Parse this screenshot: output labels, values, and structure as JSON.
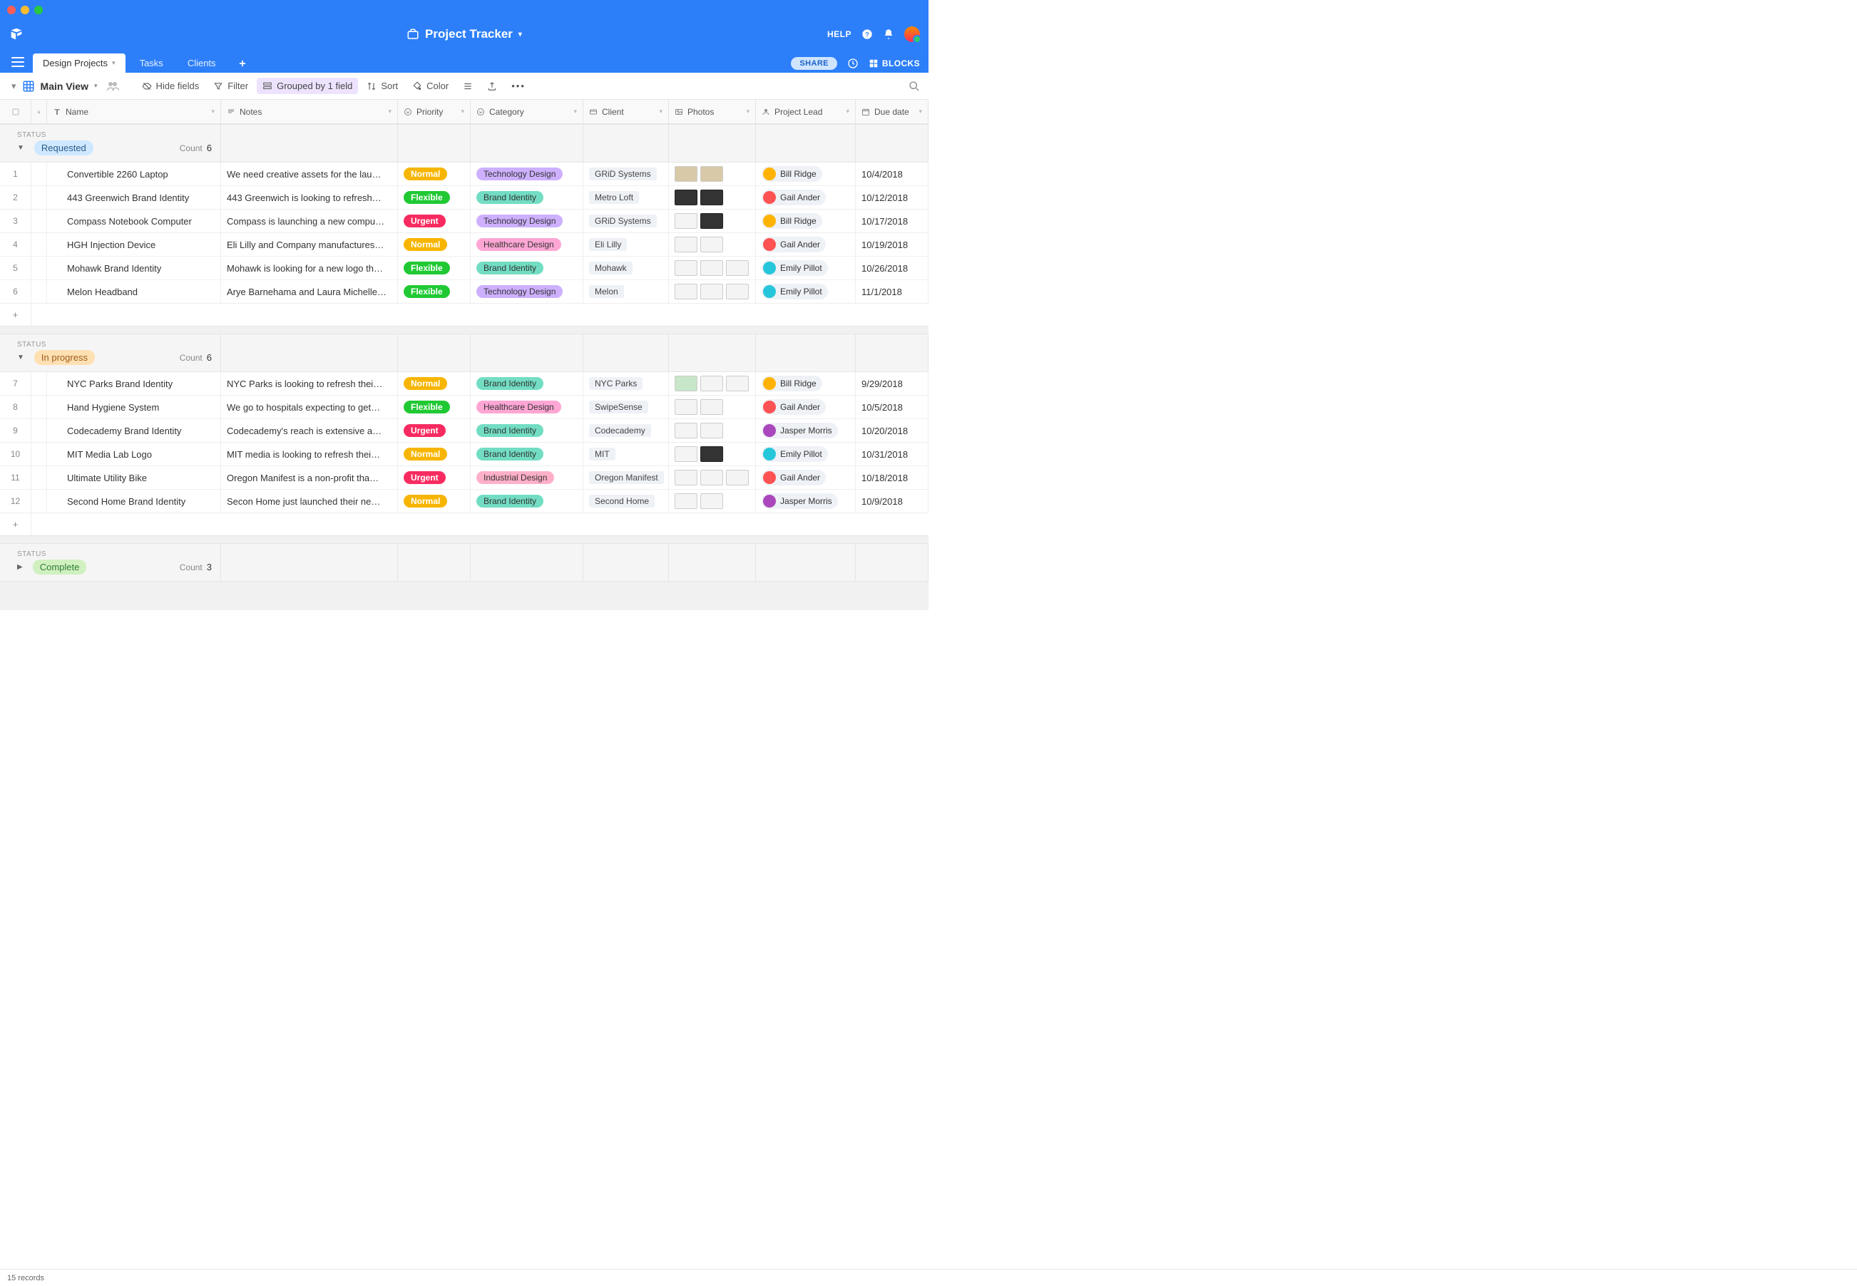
{
  "app": {
    "title": "Project Tracker",
    "help": "HELP",
    "share": "SHARE",
    "blocks": "BLOCKS"
  },
  "tabs": [
    {
      "label": "Design Projects",
      "active": true
    },
    {
      "label": "Tasks",
      "active": false
    },
    {
      "label": "Clients",
      "active": false
    }
  ],
  "view": {
    "name": "Main View",
    "hide_fields": "Hide fields",
    "filter": "Filter",
    "grouped": "Grouped by 1 field",
    "sort": "Sort",
    "color": "Color"
  },
  "columns": {
    "name": "Name",
    "notes": "Notes",
    "priority": "Priority",
    "category": "Category",
    "client": "Client",
    "photos": "Photos",
    "lead": "Project Lead",
    "due": "Due date"
  },
  "status_label": "STATUS",
  "count_label": "Count",
  "groups": [
    {
      "status": "Requested",
      "status_color": "#cfe8ff",
      "status_text": "#2a5a8a",
      "expanded": true,
      "count": 6,
      "rows": [
        {
          "n": 1,
          "name": "Convertible 2260 Laptop",
          "notes": "We need creative assets for the lau…",
          "priority": "Normal",
          "category": "Technology Design",
          "client": "GRiD Systems",
          "lead": "Bill Ridge",
          "due": "10/4/2018",
          "thumbs": [
            "tan",
            "tan"
          ]
        },
        {
          "n": 2,
          "name": "443 Greenwich Brand Identity",
          "notes": "443 Greenwich is looking to refresh…",
          "priority": "Flexible",
          "category": "Brand Identity",
          "client": "Metro Loft",
          "lead": "Gail Ander",
          "due": "10/12/2018",
          "thumbs": [
            "dark",
            "dark"
          ]
        },
        {
          "n": 3,
          "name": "Compass Notebook Computer",
          "notes": "Compass is launching a new compu…",
          "priority": "Urgent",
          "category": "Technology Design",
          "client": "GRiD Systems",
          "lead": "Bill Ridge",
          "due": "10/17/2018",
          "thumbs": [
            "light",
            "dark"
          ]
        },
        {
          "n": 4,
          "name": "HGH Injection Device",
          "notes": "Eli Lilly and Company manufactures…",
          "priority": "Normal",
          "category": "Healthcare Design",
          "client": "Eli Lilly",
          "lead": "Gail Ander",
          "due": "10/19/2018",
          "thumbs": [
            "light",
            "light"
          ]
        },
        {
          "n": 5,
          "name": "Mohawk Brand Identity",
          "notes": "Mohawk is looking for a new logo th…",
          "priority": "Flexible",
          "category": "Brand Identity",
          "client": "Mohawk",
          "lead": "Emily Pillot",
          "due": "10/26/2018",
          "thumbs": [
            "light",
            "light",
            "light"
          ]
        },
        {
          "n": 6,
          "name": "Melon Headband",
          "notes": "Arye Barnehama and Laura Michelle…",
          "priority": "Flexible",
          "category": "Technology Design",
          "client": "Melon",
          "lead": "Emily Pillot",
          "due": "11/1/2018",
          "thumbs": [
            "light",
            "light",
            "light"
          ]
        }
      ]
    },
    {
      "status": "In progress",
      "status_color": "#ffe0b2",
      "status_text": "#a05a1a",
      "expanded": true,
      "count": 6,
      "rows": [
        {
          "n": 7,
          "name": "NYC Parks Brand Identity",
          "notes": "NYC Parks is looking to refresh thei…",
          "priority": "Normal",
          "category": "Brand Identity",
          "client": "NYC Parks",
          "lead": "Bill Ridge",
          "due": "9/29/2018",
          "thumbs": [
            "green",
            "light",
            "light"
          ]
        },
        {
          "n": 8,
          "name": "Hand Hygiene System",
          "notes": "We go to hospitals expecting to get…",
          "priority": "Flexible",
          "category": "Healthcare Design",
          "client": "SwipeSense",
          "lead": "Gail Ander",
          "due": "10/5/2018",
          "thumbs": [
            "light",
            "light"
          ]
        },
        {
          "n": 9,
          "name": "Codecademy Brand Identity",
          "notes": "Codecademy's reach is extensive a…",
          "priority": "Urgent",
          "category": "Brand Identity",
          "client": "Codecademy",
          "lead": "Jasper Morris",
          "due": "10/20/2018",
          "thumbs": [
            "light",
            "light"
          ]
        },
        {
          "n": 10,
          "name": "MIT Media Lab Logo",
          "notes": "MIT media is looking to refresh thei…",
          "priority": "Normal",
          "category": "Brand Identity",
          "client": "MIT",
          "lead": "Emily Pillot",
          "due": "10/31/2018",
          "thumbs": [
            "light",
            "dark"
          ]
        },
        {
          "n": 11,
          "name": "Ultimate Utility Bike",
          "notes": "Oregon Manifest is a non-profit tha…",
          "priority": "Urgent",
          "category": "Industrial Design",
          "client": "Oregon Manifest",
          "lead": "Gail Ander",
          "due": "10/18/2018",
          "thumbs": [
            "light",
            "light",
            "light"
          ]
        },
        {
          "n": 12,
          "name": "Second Home Brand Identity",
          "notes": "Secon Home just launched their ne…",
          "priority": "Normal",
          "category": "Brand Identity",
          "client": "Second Home",
          "lead": "Jasper Morris",
          "due": "10/9/2018",
          "thumbs": [
            "light",
            "light"
          ]
        }
      ]
    },
    {
      "status": "Complete",
      "status_color": "#d0f0c0",
      "status_text": "#2e7d32",
      "expanded": false,
      "count": 3,
      "rows": []
    }
  ],
  "footer": {
    "records": "15 records"
  },
  "leads_colors": {
    "Bill Ridge": "#ffb300",
    "Gail Ander": "#ff5252",
    "Emily Pillot": "#26c6da",
    "Jasper Morris": "#ab47bc"
  },
  "priority_map": {
    "Normal": "normal",
    "Flexible": "flexible",
    "Urgent": "urgent"
  },
  "category_map": {
    "Technology Design": "tech",
    "Brand Identity": "brand",
    "Healthcare Design": "health",
    "Industrial Design": "industrial"
  }
}
